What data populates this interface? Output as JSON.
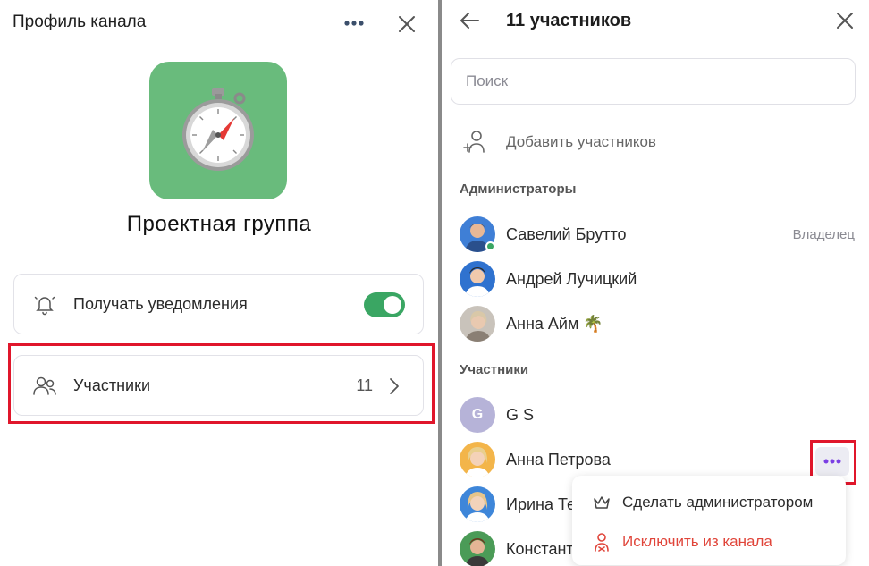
{
  "left_panel": {
    "title": "Профиль канала",
    "more_icon": "more-horizontal-icon",
    "close_icon": "close-icon",
    "channel_avatar_icon": "compass-icon",
    "group_name": "Проектная группа",
    "notifications": {
      "icon": "bell-icon",
      "label": "Получать уведомления",
      "enabled": true
    },
    "members": {
      "icon": "users-icon",
      "label": "Участники",
      "count": "11",
      "chevron_icon": "chevron-right-icon"
    }
  },
  "right_panel": {
    "back_icon": "arrow-left-icon",
    "title": "11 участников",
    "close_icon": "close-icon",
    "search": {
      "placeholder": "Поиск",
      "value": ""
    },
    "add_members": {
      "icon": "add-user-icon",
      "label": "Добавить участников"
    },
    "admins_section": "Администраторы",
    "members_section": "Участники",
    "admins": [
      {
        "name": "Савелий Брутто",
        "role": "Владелец",
        "online": true
      },
      {
        "name": "Андрей Лучицкий"
      },
      {
        "name": "Анна Айм 🌴"
      }
    ],
    "members": [
      {
        "name": "G S",
        "initial": "G"
      },
      {
        "name": "Анна Петрова"
      },
      {
        "name": "Ирина Те"
      },
      {
        "name": "Констант"
      }
    ],
    "row_more_icon": "more-horizontal-icon",
    "context_menu": {
      "make_admin": {
        "icon": "crown-icon",
        "label": "Сделать администратором"
      },
      "remove": {
        "icon": "remove-user-icon",
        "label": "Исключить из канала"
      }
    }
  },
  "colors": {
    "accent_green": "#3aa663",
    "avatar_green": "#69bb7c",
    "highlight_red": "#e0162b",
    "danger_red": "#e0453a",
    "dots_purple": "#7b3fe4"
  }
}
